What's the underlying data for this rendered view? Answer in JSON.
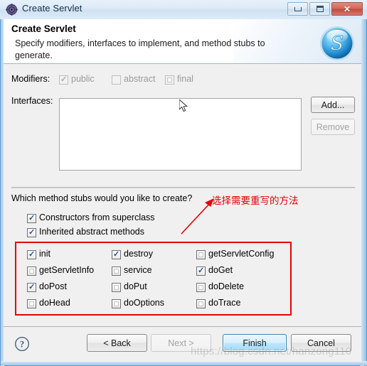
{
  "window": {
    "title": "Create Servlet",
    "icon": "gear-icon",
    "controls": {
      "minimize": "minimize-icon",
      "maximize": "maximize-icon",
      "close": "✕"
    }
  },
  "header": {
    "title": "Create Servlet",
    "description": "Specify modifiers, interfaces to implement, and method stubs to generate.",
    "logo_letter": "S"
  },
  "form": {
    "modifiers_label": "Modifiers:",
    "modifiers": [
      {
        "label": "public",
        "checked": true,
        "enabled": false,
        "style": "check"
      },
      {
        "label": "abstract",
        "checked": false,
        "enabled": false,
        "style": "empty"
      },
      {
        "label": "final",
        "checked": false,
        "enabled": false,
        "style": "square"
      }
    ],
    "interfaces_label": "Interfaces:",
    "interfaces_items": [],
    "add_button": "Add...",
    "remove_button": "Remove"
  },
  "stubs": {
    "question": "Which method stubs would you like to create?",
    "top_options": [
      {
        "label": "Constructors from superclass",
        "checked": true
      },
      {
        "label": "Inherited abstract methods",
        "checked": true
      }
    ],
    "grid": [
      [
        {
          "label": "init",
          "checked": true
        },
        {
          "label": "destroy",
          "checked": true
        },
        {
          "label": "getServletConfig",
          "checked": false
        }
      ],
      [
        {
          "label": "getServletInfo",
          "checked": false
        },
        {
          "label": "service",
          "checked": false
        },
        {
          "label": "doGet",
          "checked": true
        }
      ],
      [
        {
          "label": "doPost",
          "checked": true
        },
        {
          "label": "doPut",
          "checked": false
        },
        {
          "label": "doDelete",
          "checked": false
        }
      ],
      [
        {
          "label": "doHead",
          "checked": false
        },
        {
          "label": "doOptions",
          "checked": false
        },
        {
          "label": "doTrace",
          "checked": false
        }
      ]
    ]
  },
  "annotation": {
    "text": "选择需要重写的方法",
    "color": "#e60000"
  },
  "footer": {
    "help": "?",
    "back": "< Back",
    "next": "Next >",
    "finish": "Finish",
    "cancel": "Cancel"
  },
  "watermark": "https://blog.csdn.net/hanzong110",
  "colors": {
    "accent": "#3c7fb1",
    "annotation_red": "#e60000",
    "panel": "#f0f0f0",
    "frame": "#5a9ed6"
  }
}
